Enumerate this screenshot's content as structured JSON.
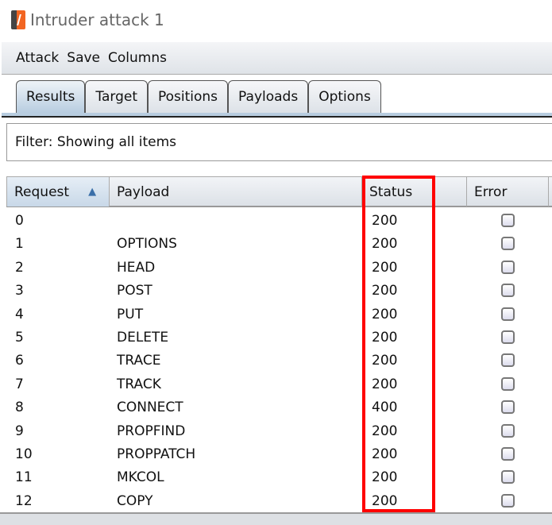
{
  "window": {
    "title": "Intruder attack 1"
  },
  "menu": [
    "Attack",
    "Save",
    "Columns"
  ],
  "tabs": [
    "Results",
    "Target",
    "Positions",
    "Payloads",
    "Options"
  ],
  "filter": "Filter:  Showing all items",
  "columns": [
    "Request",
    "Payload",
    "Status",
    "Error"
  ],
  "rows": [
    {
      "request": "0",
      "payload": "",
      "status": "200"
    },
    {
      "request": "1",
      "payload": "OPTIONS",
      "status": "200"
    },
    {
      "request": "2",
      "payload": "HEAD",
      "status": "200"
    },
    {
      "request": "3",
      "payload": "POST",
      "status": "200"
    },
    {
      "request": "4",
      "payload": "PUT",
      "status": "200"
    },
    {
      "request": "5",
      "payload": "DELETE",
      "status": "200"
    },
    {
      "request": "6",
      "payload": "TRACE",
      "status": "200"
    },
    {
      "request": "7",
      "payload": "TRACK",
      "status": "200"
    },
    {
      "request": "8",
      "payload": "CONNECT",
      "status": "400"
    },
    {
      "request": "9",
      "payload": "PROPFIND",
      "status": "200"
    },
    {
      "request": "10",
      "payload": "PROPPATCH",
      "status": "200"
    },
    {
      "request": "11",
      "payload": "MKCOL",
      "status": "200"
    },
    {
      "request": "12",
      "payload": "COPY",
      "status": "200"
    }
  ],
  "highlight_color": "#ff0000"
}
